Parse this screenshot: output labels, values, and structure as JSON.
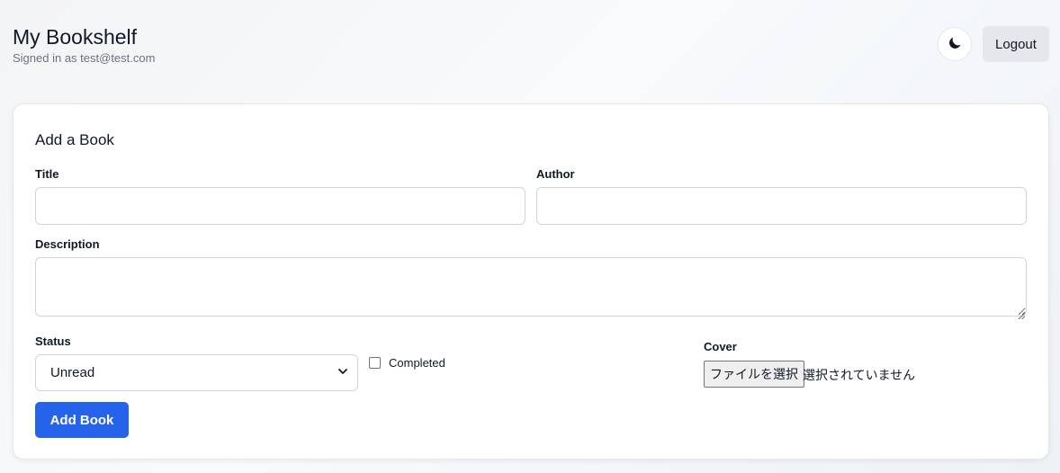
{
  "header": {
    "title": "My Bookshelf",
    "signed_in_text": "Signed in as test@test.com",
    "theme_icon": "moon-icon",
    "logout_label": "Logout"
  },
  "form": {
    "title": "Add a Book",
    "title_label": "Title",
    "title_value": "",
    "author_label": "Author",
    "author_value": "",
    "description_label": "Description",
    "description_value": "",
    "status_label": "Status",
    "status_value": "Unread",
    "completed_label": "Completed",
    "completed_checked": false,
    "cover_label": "Cover",
    "file_button_label": "ファイルを選択",
    "file_status": "選択されていません",
    "submit_label": "Add Book"
  },
  "colors": {
    "accent": "#2563eb",
    "logout_bg": "#e5e7eb",
    "border": "#d1d5db"
  }
}
